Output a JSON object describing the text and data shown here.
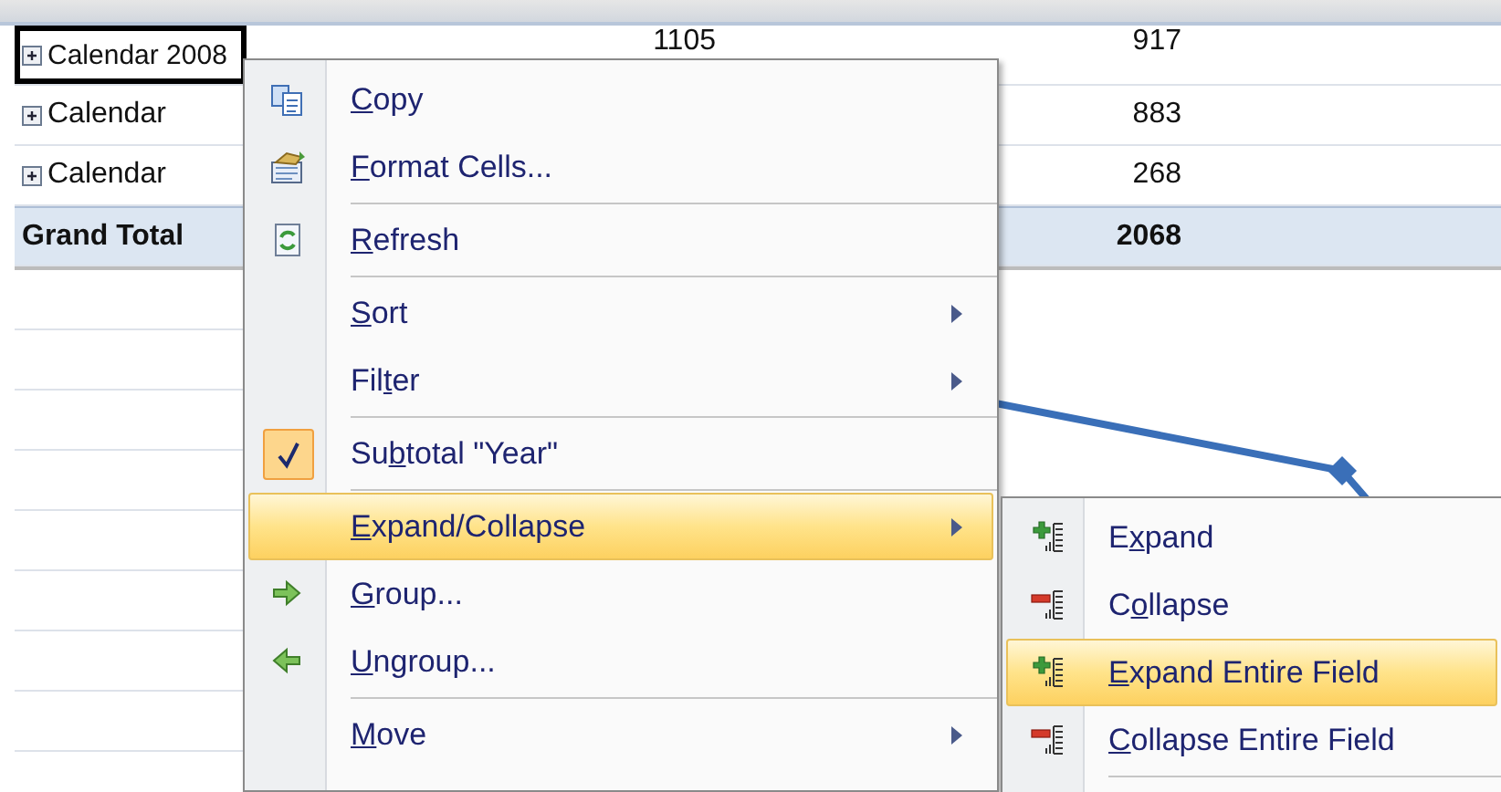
{
  "sheet": {
    "rows": [
      {
        "label": "Calendar 2008",
        "expandable": true,
        "active": true,
        "column_2": "1105",
        "column_3": "917"
      },
      {
        "label": "Calendar",
        "expandable": true,
        "column_3": "883"
      },
      {
        "label": "Calendar",
        "expandable": true,
        "column_3": "268"
      },
      {
        "label": "Grand Total",
        "total": true,
        "column_3": "2068"
      }
    ]
  },
  "context_menu": {
    "groups": [
      [
        {
          "kind": "copy",
          "label": [
            {
              "text": "C",
              "access_key": true
            },
            {
              "text": "opy",
              "access_key": false
            }
          ],
          "has_submenu": false,
          "selected": false
        },
        {
          "kind": "format",
          "label": [
            {
              "text": "F",
              "access_key": true
            },
            {
              "text": "ormat Cells...",
              "access_key": false
            }
          ],
          "has_submenu": false,
          "selected": false
        }
      ],
      [
        {
          "kind": "refresh",
          "label": [
            {
              "text": "R",
              "access_key": true
            },
            {
              "text": "efresh",
              "access_key": false
            }
          ],
          "has_submenu": false,
          "selected": false
        }
      ],
      [
        {
          "kind": "plain",
          "label": [
            {
              "text": "S",
              "access_key": true
            },
            {
              "text": "ort",
              "access_key": false
            }
          ],
          "has_submenu": true,
          "selected": false
        },
        {
          "kind": "plain",
          "label": [
            {
              "text": "Fil",
              "access_key": false
            },
            {
              "text": "t",
              "access_key": true
            },
            {
              "text": "er",
              "access_key": false
            }
          ],
          "has_submenu": true,
          "selected": false
        }
      ],
      [
        {
          "kind": "check",
          "checked": true,
          "label": [
            {
              "text": "Su",
              "access_key": false
            },
            {
              "text": "b",
              "access_key": true
            },
            {
              "text": "total \"Year\"",
              "access_key": false
            }
          ],
          "has_submenu": false,
          "selected": false
        }
      ],
      [
        {
          "kind": "plain",
          "label": [
            {
              "text": "E",
              "access_key": true
            },
            {
              "text": "xpand/Collapse",
              "access_key": false
            }
          ],
          "has_submenu": true,
          "selected": true
        },
        {
          "kind": "group",
          "label": [
            {
              "text": "G",
              "access_key": true
            },
            {
              "text": "roup...",
              "access_key": false
            }
          ],
          "has_submenu": false,
          "selected": false
        },
        {
          "kind": "ungroup",
          "label": [
            {
              "text": "U",
              "access_key": true
            },
            {
              "text": "ngroup...",
              "access_key": false
            }
          ],
          "has_submenu": false,
          "selected": false
        }
      ],
      [
        {
          "kind": "plain",
          "label": [
            {
              "text": "M",
              "access_key": true
            },
            {
              "text": "ove",
              "access_key": false
            }
          ],
          "has_submenu": true,
          "selected": false
        }
      ]
    ]
  },
  "submenu": {
    "groups": [
      [
        {
          "kind": "expand",
          "label": [
            {
              "text": "E",
              "access_key": false
            },
            {
              "text": "x",
              "access_key": true
            },
            {
              "text": "pand",
              "access_key": false
            }
          ],
          "has_submenu": false,
          "selected": false
        },
        {
          "kind": "collapse",
          "label": [
            {
              "text": "C",
              "access_key": false
            },
            {
              "text": "o",
              "access_key": true
            },
            {
              "text": "llapse",
              "access_key": false
            }
          ],
          "has_submenu": false,
          "selected": false
        },
        {
          "kind": "expand",
          "label": [
            {
              "text": "E",
              "access_key": true
            },
            {
              "text": "xpand Entire Field",
              "access_key": false
            }
          ],
          "has_submenu": false,
          "selected": true
        },
        {
          "kind": "collapse",
          "label": [
            {
              "text": "C",
              "access_key": true
            },
            {
              "text": "ollapse Entire Field",
              "access_key": false
            }
          ],
          "has_submenu": false,
          "selected": false
        }
      ]
    ],
    "separator_after": true
  }
}
